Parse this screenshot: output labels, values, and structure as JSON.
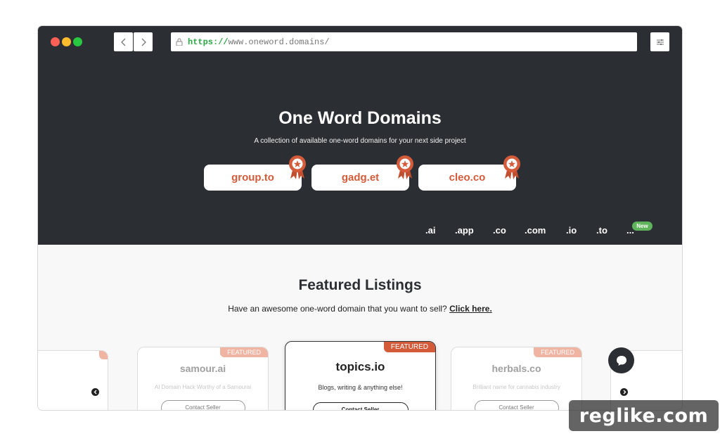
{
  "browser": {
    "url_scheme": "https://",
    "url_rest": "www.oneword.domains/",
    "back_icon": "chevron-left-icon",
    "forward_icon": "chevron-right-icon",
    "menu_icon": "sliders-icon"
  },
  "hero": {
    "title": "One Word Domains",
    "subtitle": "A collection of available one-word domains for your next side project",
    "pills": [
      {
        "label": "group.to"
      },
      {
        "label": "gadg.et"
      },
      {
        "label": "cleo.co"
      }
    ],
    "tlds": [
      ".ai",
      ".app",
      ".co",
      ".com",
      ".io",
      ".to",
      "..."
    ],
    "new_badge": "New"
  },
  "featured": {
    "title": "Featured Listings",
    "subtitle": "Have an awesome one-word domain that you want to sell?",
    "link": "Click here.",
    "cards": [
      {
        "badge": "FEATURED",
        "name": "samour.ai",
        "desc": "AI Domain Hack Worthy of a Samourai",
        "button": "Contact Seller"
      },
      {
        "badge": "FEATURED",
        "name": "topics.io",
        "desc": "Blogs, writing & anything else!",
        "button": "Contact Seller"
      },
      {
        "badge": "FEATURED",
        "name": "herbals.co",
        "desc": "Brilliant name for cannabis industry",
        "button": "Contact Seller"
      }
    ]
  },
  "watermark": "reglike.com",
  "colors": {
    "dark_bg": "#2b2f33",
    "accent": "#d45b3a",
    "new_badge": "#5fb45b"
  }
}
